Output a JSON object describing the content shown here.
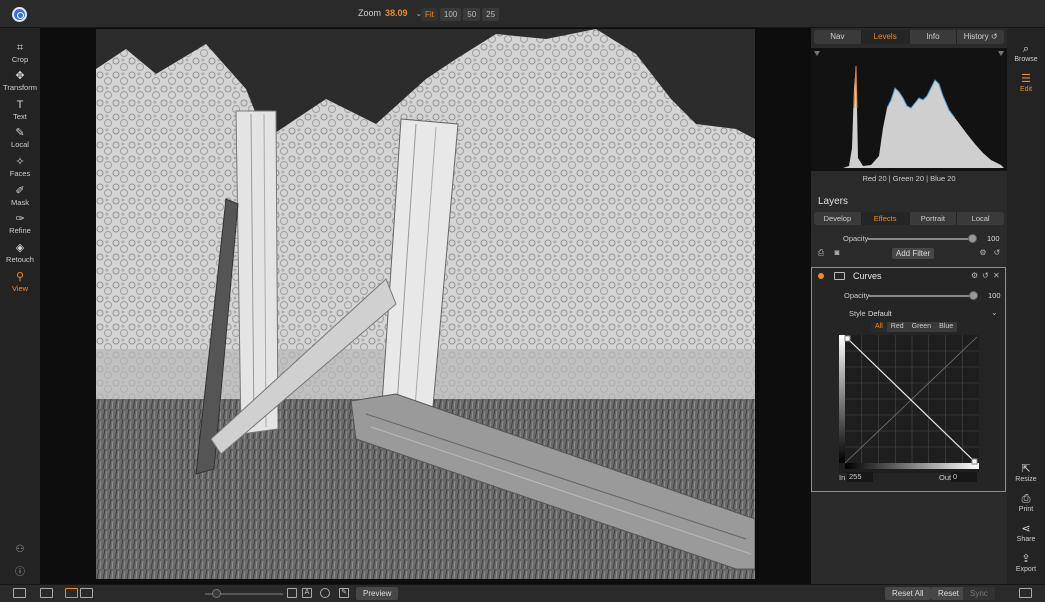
{
  "topbar": {
    "zoom_label": "Zoom",
    "zoom_value": "38.09",
    "zoom_presets": [
      "Fit",
      "100",
      "50",
      "25"
    ],
    "active_preset": "Fit"
  },
  "left_tools": [
    {
      "label": "Crop",
      "icon": "crop-icon"
    },
    {
      "label": "Transform",
      "icon": "move-icon"
    },
    {
      "label": "Text",
      "icon": "text-icon"
    },
    {
      "label": "Local",
      "icon": "brush-icon"
    },
    {
      "label": "Faces",
      "icon": "faces-icon"
    },
    {
      "label": "Mask",
      "icon": "mask-icon"
    },
    {
      "label": "Refine",
      "icon": "refine-icon"
    },
    {
      "label": "Retouch",
      "icon": "retouch-icon"
    },
    {
      "label": "View",
      "icon": "view-icon",
      "active": true
    }
  ],
  "panel": {
    "tabs": [
      "Nav",
      "Levels",
      "Info",
      "History"
    ],
    "active_tab": "Levels",
    "hist_readout": "Red  20   | Green  20   | Blue  20",
    "layers_title": "Layers",
    "layer_tabs": [
      "Develop",
      "Effects",
      "Portrait",
      "Local"
    ],
    "active_layer_tab": "Effects",
    "layer_opacity_label": "Opacity",
    "layer_opacity_value": "100",
    "add_filter": "Add Filter"
  },
  "curves": {
    "title": "Curves",
    "opacity_label": "Opacity",
    "opacity_value": "100",
    "style_label": "Style",
    "style_value": "Default",
    "channels": [
      "All",
      "Red",
      "Green",
      "Blue"
    ],
    "active_channel": "All",
    "in_label": "In",
    "in_value": "255",
    "out_label": "Out",
    "out_value": "0"
  },
  "right_rail": [
    {
      "label": "Browse",
      "icon": "browse-icon"
    },
    {
      "label": "Edit",
      "icon": "edit-sliders-icon",
      "active": true
    },
    {
      "label": "Resize",
      "icon": "resize-icon"
    },
    {
      "label": "Print",
      "icon": "print-icon"
    },
    {
      "label": "Share",
      "icon": "share-icon"
    },
    {
      "label": "Export",
      "icon": "export-icon"
    }
  ],
  "bottombar": {
    "preview": "Preview",
    "reset_all": "Reset All",
    "reset": "Reset",
    "sync": "Sync"
  },
  "colors": {
    "accent": "#f08a24",
    "panel": "#2a2a2a"
  }
}
